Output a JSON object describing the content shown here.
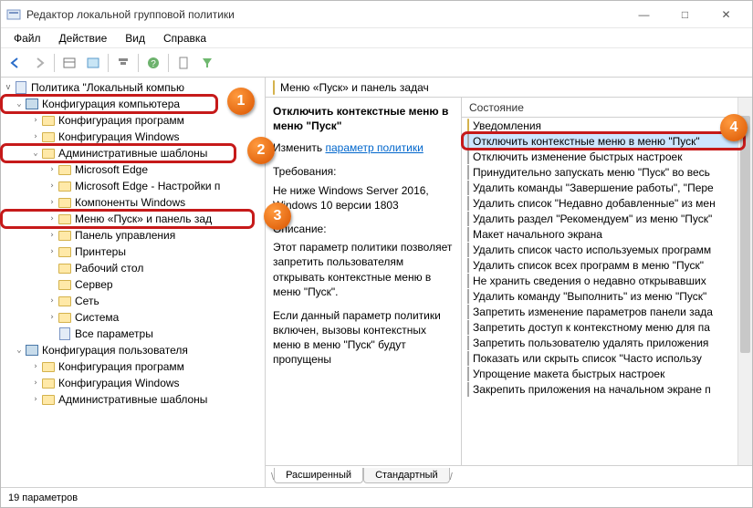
{
  "window": {
    "title": "Редактор локальной групповой политики",
    "minimize": "—",
    "maximize": "□",
    "close": "✕"
  },
  "menu": [
    "Файл",
    "Действие",
    "Вид",
    "Справка"
  ],
  "tree": {
    "root": "Политика \"Локальный компью",
    "items": [
      {
        "depth": 0,
        "exp": "v",
        "icon": "comp",
        "label": "Конфигурация компьютера",
        "hl": 1
      },
      {
        "depth": 1,
        "exp": ">",
        "icon": "folder",
        "label": "Конфигурация программ"
      },
      {
        "depth": 1,
        "exp": ">",
        "icon": "folder",
        "label": "Конфигурация Windows"
      },
      {
        "depth": 1,
        "exp": "v",
        "icon": "folder",
        "label": "Административные шаблоны",
        "hl": 2
      },
      {
        "depth": 2,
        "exp": ">",
        "icon": "folder",
        "label": "Microsoft Edge"
      },
      {
        "depth": 2,
        "exp": ">",
        "icon": "folder",
        "label": "Microsoft Edge - Настройки п"
      },
      {
        "depth": 2,
        "exp": ">",
        "icon": "folder",
        "label": "Компоненты Windows"
      },
      {
        "depth": 2,
        "exp": ">",
        "icon": "folder",
        "label": "Меню «Пуск» и панель зад",
        "hl": 3
      },
      {
        "depth": 2,
        "exp": ">",
        "icon": "folder",
        "label": "Панель управления"
      },
      {
        "depth": 2,
        "exp": ">",
        "icon": "folder",
        "label": "Принтеры"
      },
      {
        "depth": 2,
        "exp": "",
        "icon": "folder",
        "label": "Рабочий стол"
      },
      {
        "depth": 2,
        "exp": "",
        "icon": "folder",
        "label": "Сервер"
      },
      {
        "depth": 2,
        "exp": ">",
        "icon": "folder",
        "label": "Сеть"
      },
      {
        "depth": 2,
        "exp": ">",
        "icon": "folder",
        "label": "Система"
      },
      {
        "depth": 2,
        "exp": "",
        "icon": "policy",
        "label": "Все параметры"
      },
      {
        "depth": 0,
        "exp": "v",
        "icon": "comp",
        "label": "Конфигурация пользователя"
      },
      {
        "depth": 1,
        "exp": ">",
        "icon": "folder",
        "label": "Конфигурация программ"
      },
      {
        "depth": 1,
        "exp": ">",
        "icon": "folder",
        "label": "Конфигурация Windows"
      },
      {
        "depth": 1,
        "exp": ">",
        "icon": "folder",
        "label": "Административные шаблоны"
      }
    ]
  },
  "path": "Меню «Пуск» и панель задач",
  "detail": {
    "title": "Отключить контекстные меню в меню \"Пуск\"",
    "edit_prefix": "Изменить ",
    "edit_link": "параметр политики",
    "req_label": "Требования:",
    "req_text": "Не ниже Windows Server 2016, Windows 10 версии 1803",
    "desc_label": "Описание:",
    "desc_text": "Этот параметр политики позволяет запретить пользователям открывать контекстные меню в меню \"Пуск\".",
    "desc_text2": "Если данный параметр политики включен, вызовы контекстных меню в меню \"Пуск\" будут пропущены"
  },
  "col_header": "Состояние",
  "list": [
    {
      "icon": "folder",
      "label": "Уведомления"
    },
    {
      "icon": "item",
      "label": "Отключить контекстные меню в меню \"Пуск\"",
      "sel": true,
      "hl": 4
    },
    {
      "icon": "item",
      "label": "Отключить изменение быстрых настроек"
    },
    {
      "icon": "item",
      "label": "Принудительно запускать меню \"Пуск\" во весь"
    },
    {
      "icon": "item",
      "label": "Удалить команды \"Завершение работы\", \"Пере"
    },
    {
      "icon": "item",
      "label": "Удалить список \"Недавно добавленные\" из мен"
    },
    {
      "icon": "item",
      "label": "Удалить раздел \"Рекомендуем\" из меню \"Пуск\""
    },
    {
      "icon": "item",
      "label": "Макет начального экрана"
    },
    {
      "icon": "item",
      "label": "Удалить список часто используемых программ"
    },
    {
      "icon": "item",
      "label": "Удалить список всех программ в меню \"Пуск\""
    },
    {
      "icon": "item",
      "label": "Не хранить сведения о недавно открывавших"
    },
    {
      "icon": "item",
      "label": "Удалить команду \"Выполнить\" из меню \"Пуск\""
    },
    {
      "icon": "item",
      "label": "Запретить изменение параметров панели зада"
    },
    {
      "icon": "item",
      "label": "Запретить доступ к контекстному меню для па"
    },
    {
      "icon": "item",
      "label": "Запретить пользователю удалять приложения"
    },
    {
      "icon": "item",
      "label": "Показать или скрыть список \"Часто использу"
    },
    {
      "icon": "item",
      "label": "Упрощение макета быстрых настроек"
    },
    {
      "icon": "item",
      "label": "Закрепить приложения на начальном экране п"
    }
  ],
  "tabs": {
    "extended": "Расширенный",
    "standard": "Стандартный"
  },
  "status": "19 параметров"
}
